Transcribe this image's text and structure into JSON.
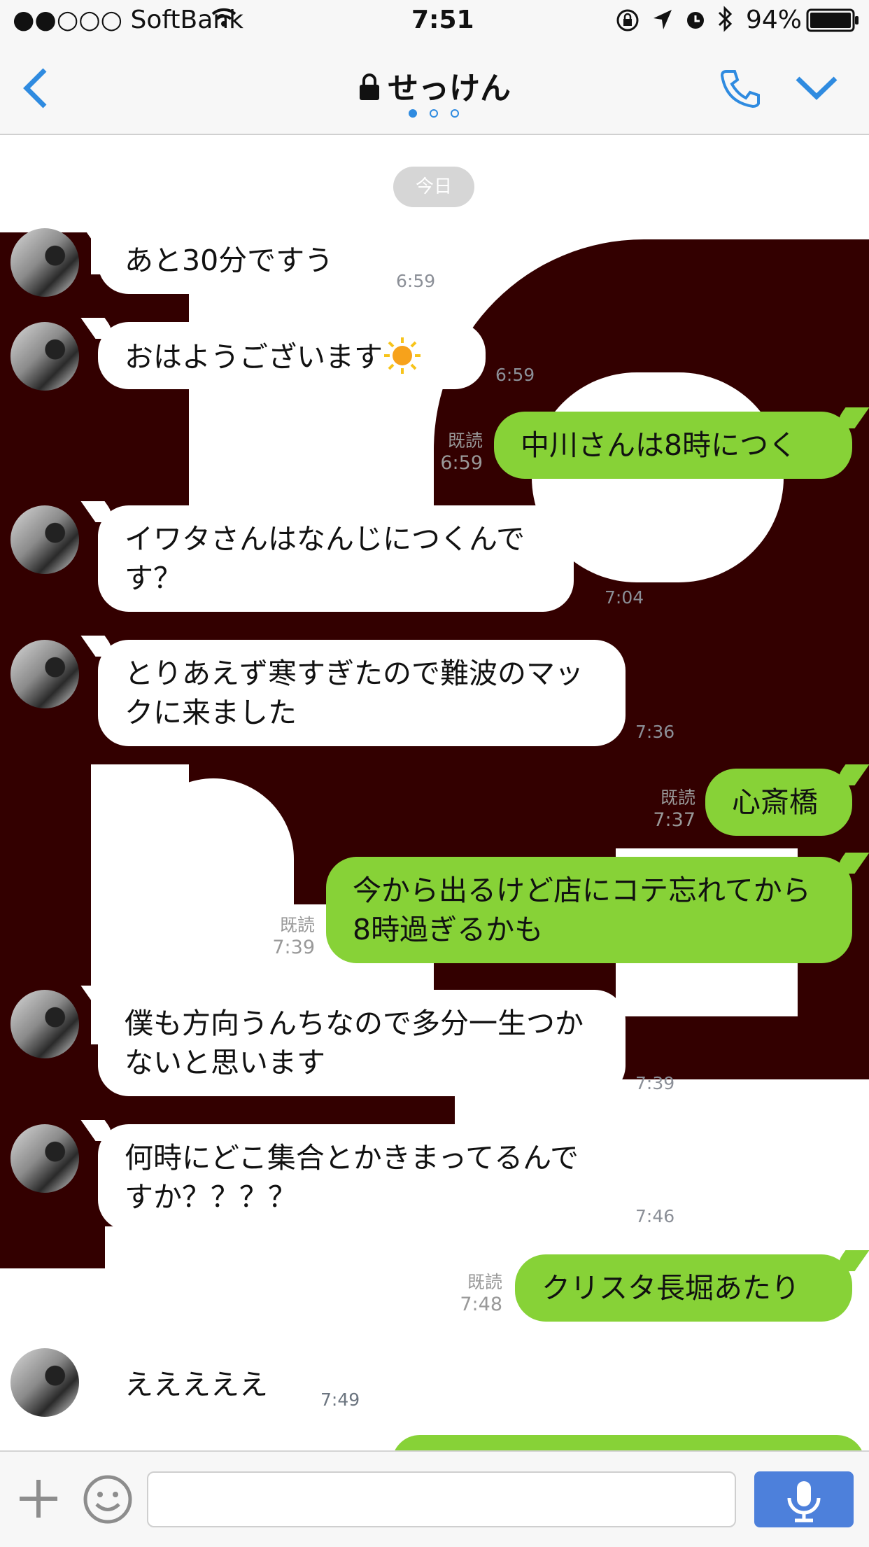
{
  "status_bar": {
    "carrier": "●●○○○ SoftBank",
    "time": "7:51",
    "battery": "94%"
  },
  "header": {
    "title": "せっけん"
  },
  "date_separator": "今日",
  "messages": [
    {
      "side": "in",
      "text": "あと30分ですう",
      "time": "6:59"
    },
    {
      "side": "in",
      "text": "おはようございます",
      "time": "6:59"
    },
    {
      "side": "out",
      "text": "中川さんは8時につく",
      "read": "既読",
      "time": "6:59"
    },
    {
      "side": "in",
      "text": "イワタさんはなんじにつくんです？",
      "time": "7:04"
    },
    {
      "side": "in",
      "text": "とりあえず寒すぎたので難波のマックに来ました",
      "time": "7:36"
    },
    {
      "side": "out",
      "text": "心斎橋",
      "read": "既読",
      "time": "7:37"
    },
    {
      "side": "out",
      "text": "今から出るけど店にコテ忘れてから8時過ぎるかも",
      "read": "既読",
      "time": "7:39"
    },
    {
      "side": "in",
      "text": "僕も方向うんちなので多分一生つかないと思います",
      "time": "7:39"
    },
    {
      "side": "in",
      "text": "何時にどこ集合とかきまってるんですか？？？？",
      "time": "7:46"
    },
    {
      "side": "out",
      "text": "クリスタ長堀あたり",
      "read": "既読",
      "time": "7:48"
    },
    {
      "side": "in",
      "text": "えええええ",
      "time": "7:49"
    }
  ],
  "icons": {
    "back": "chevron-left-icon",
    "lock": "lock-icon",
    "call": "phone-icon",
    "menu": "chevron-down-icon",
    "add": "plus-icon",
    "sticker": "smiley-icon",
    "voice": "microphone-icon",
    "sun": "sun-emoji"
  },
  "colors": {
    "accent": "#2f8be0",
    "outgoing_bubble": "#87d237",
    "mic_button": "#4d80db",
    "wallpaper_dark": "#330000"
  }
}
